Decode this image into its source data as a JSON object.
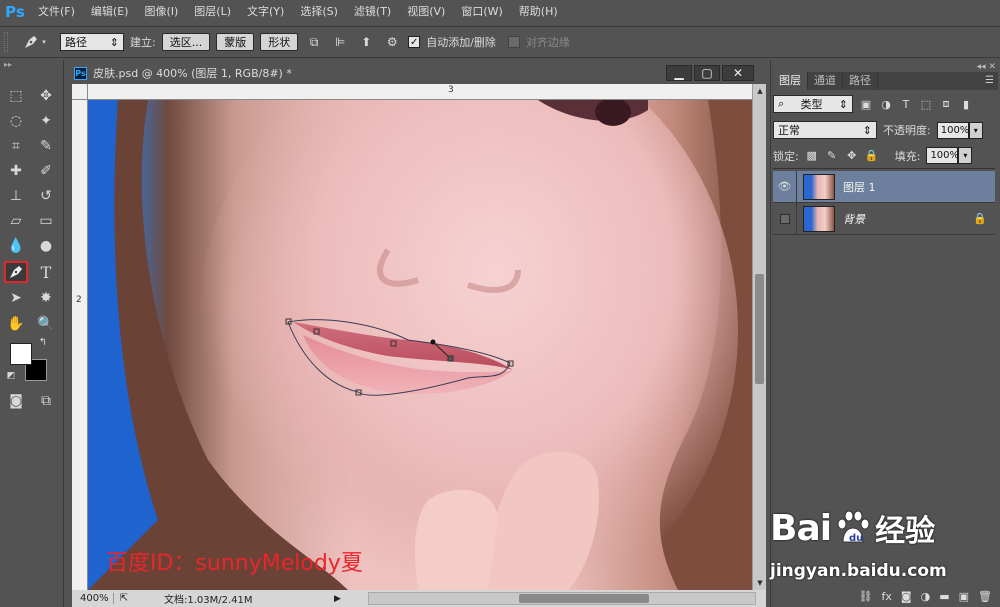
{
  "app": {
    "logo": "Ps"
  },
  "menu": [
    "文件(F)",
    "编辑(E)",
    "图像(I)",
    "图层(L)",
    "文字(Y)",
    "选择(S)",
    "滤镜(T)",
    "视图(V)",
    "窗口(W)",
    "帮助(H)"
  ],
  "options": {
    "mode_select": "路径",
    "build_label": "建立:",
    "selection_btn": "选区...",
    "mask_btn": "蒙版",
    "shape_btn": "形状",
    "auto_add_delete": "自动添加/删除",
    "auto_add_checked": true,
    "align_edges": "对齐边缘",
    "align_edges_checked": false
  },
  "document": {
    "title": "皮肤.psd @ 400% (图层 1, RGB/8#) *",
    "ruler_top_mark": "3",
    "ruler_left_mark": "2",
    "watermark": "百度ID：sunnyMelody夏",
    "zoom": "400%",
    "doc_size": "文档:1.03M/2.41M"
  },
  "layers_panel": {
    "tabs": [
      "图层",
      "通道",
      "路径"
    ],
    "active_tab": "图层",
    "filter_select": "类型",
    "blend_mode": "正常",
    "opacity_label": "不透明度:",
    "opacity": "100%",
    "lock_label": "锁定:",
    "fill_label": "填充:",
    "fill": "100%",
    "layers": [
      {
        "name": "图层 1",
        "visible": true,
        "selected": true,
        "locked": false
      },
      {
        "name": "背景",
        "visible": false,
        "selected": false,
        "locked": true
      }
    ]
  },
  "watermark_brand": {
    "logo_text": "Bai",
    "logo_text2": "经验",
    "url": "jingyan.baidu.com"
  },
  "colors": {
    "foreground": "#ffffff",
    "background": "#000000",
    "selected_layer": "#6c7f9c",
    "highlight": "#e0282c"
  }
}
